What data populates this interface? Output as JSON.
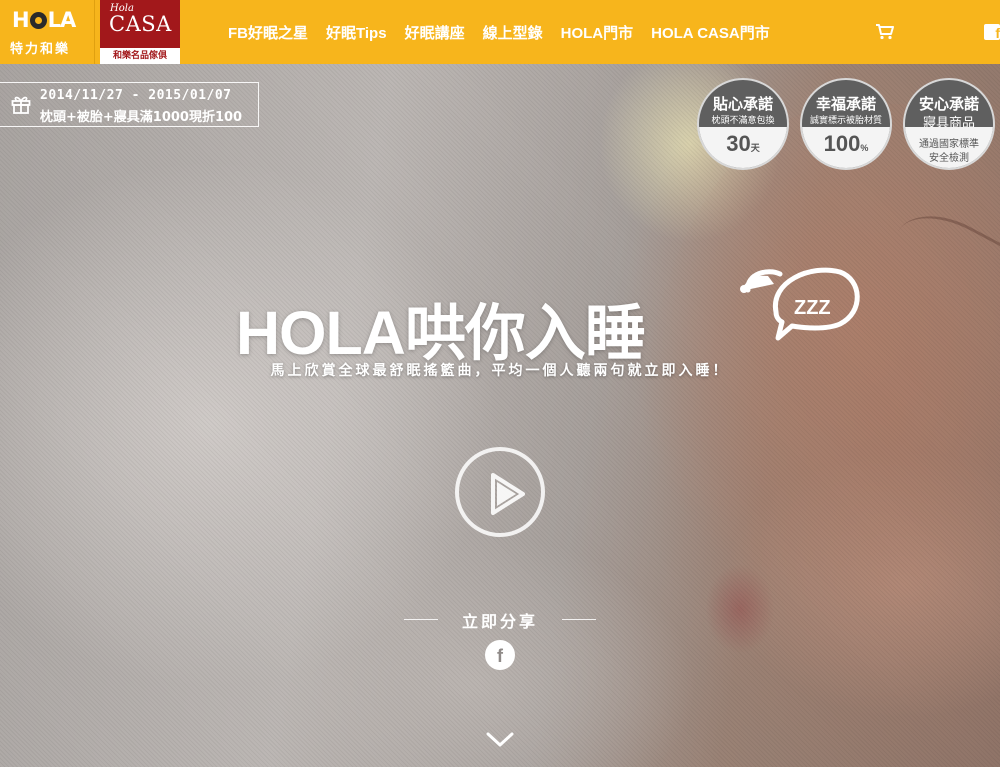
{
  "header": {
    "hola_logo": {
      "word": "HOLA",
      "sub": "特力和樂"
    },
    "casa_logo": {
      "script": "Hola",
      "word": "CASA",
      "sub": "和樂名品傢俱"
    },
    "nav": [
      {
        "label": "FB好眠之星"
      },
      {
        "label": "好眠Tips"
      },
      {
        "label": "好眠講座"
      },
      {
        "label": "線上型錄"
      },
      {
        "label": "HOLA門市"
      },
      {
        "label": "HOLA CASA門市"
      }
    ],
    "cart_icon": "shopping-cart-icon",
    "facebook_icon": "facebook-icon",
    "facebook_glyph": "f"
  },
  "promo": {
    "date": "2014/11/27 - 2015/01/07",
    "offer": "枕頭+被胎+寢具滿1000現折100",
    "icon": "gift-icon"
  },
  "badges": [
    {
      "title": "貼心承諾",
      "desc": "枕頭不滿意包換",
      "num": "30",
      "unit": "天"
    },
    {
      "title": "幸福承諾",
      "desc": "誠實標示被胎材質",
      "num": "100",
      "unit": "%"
    },
    {
      "title": "安心承諾",
      "desc": "寢具商品",
      "line1": "通過國家標準",
      "line2": "安全檢測"
    }
  ],
  "hero": {
    "headline": "HOLA哄你入睡",
    "zzz": "ZZZ",
    "tagline": "馬上欣賞全球最舒眠搖籃曲，平均一個人聽兩句就立即入睡！",
    "share_label": "立即分享",
    "facebook_glyph": "f"
  },
  "colors": {
    "brand_yellow": "#f7b51c",
    "casa_red": "#a2181b",
    "badge_dark": "#5f5f5f"
  }
}
